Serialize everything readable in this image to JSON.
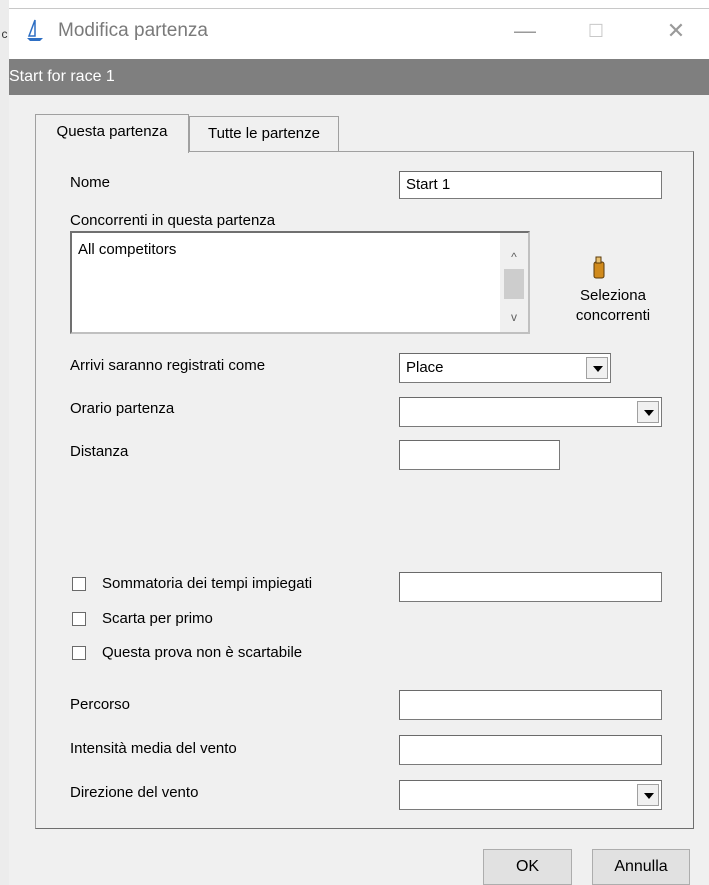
{
  "window": {
    "title": "Modifica partenza",
    "caption": "Start for race 1",
    "minimize_glyph": "—",
    "maximize_glyph": "☐",
    "close_glyph": "✕",
    "icon": "sailboat-icon"
  },
  "tabs": [
    {
      "label": "Questa partenza",
      "active": true
    },
    {
      "label": "Tutte le partenze",
      "active": false
    }
  ],
  "form": {
    "nome_label": "Nome",
    "nome_value": "Start 1",
    "concorrenti_label": "Concorrenti in questa partenza",
    "concorrenti_items": [
      "All competitors"
    ],
    "seleziona_label_1": "Seleziona",
    "seleziona_label_2": "concorrenti",
    "arrivi_label": "Arrivi saranno registrati come",
    "arrivi_value": "Place",
    "orario_label": "Orario partenza",
    "orario_value": "",
    "distanza_label": "Distanza",
    "distanza_value": "",
    "sommatoria_label": "Sommatoria dei tempi impiegati",
    "sommatoria_value": "",
    "scarta_label": "Scarta per primo",
    "non_scartabile_label": "Questa prova non è scartabile",
    "percorso_label": "Percorso",
    "percorso_value": "",
    "vento_intensita_label": "Intensità media del vento",
    "vento_intensita_value": "",
    "vento_direzione_label": "Direzione del vento",
    "vento_direzione_value": ""
  },
  "buttons": {
    "ok": "OK",
    "annulla": "Annulla"
  },
  "scroll_glyphs": {
    "up": "^",
    "down": "v"
  }
}
